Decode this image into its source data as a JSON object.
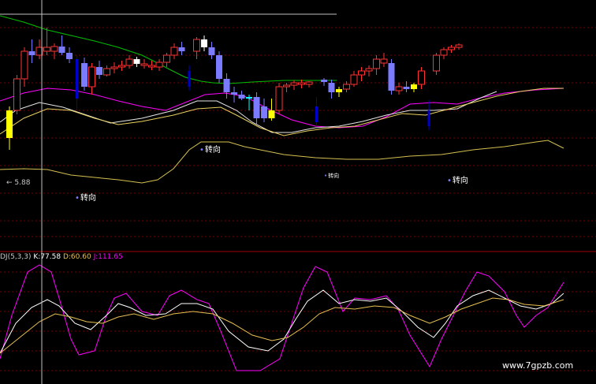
{
  "colors": {
    "background": "#000000",
    "grid": "#7a0000",
    "upper_band": "#00c000",
    "middle_band": "#ff00ff",
    "lower_band": "#d4c050",
    "ma_white": "#e6e6e6",
    "ma_yellow": "#e8d060",
    "candle_up": "#ff3333",
    "candle_down": "#7b7bff",
    "candle_down_solid": "#0000cc",
    "candle_yellow": "#ffff00",
    "candle_cyan": "#00ffff",
    "k_line": "#ffffff",
    "d_line": "#e8c050",
    "j_line": "#ff00ff",
    "crosshair": "#c0c0c0"
  },
  "price_label": "← 5.88",
  "signals": [
    {
      "id": "signal-1",
      "text": "转向"
    },
    {
      "id": "signal-2",
      "text": "转向"
    },
    {
      "id": "signal-3",
      "text": "转向"
    },
    {
      "id": "signal-4",
      "text": "转向"
    }
  ],
  "kdj_legend": {
    "name": "DJ(5,3,3)",
    "k_label": "K:77.58",
    "d_label": "D:60.60",
    "j_label": "J:111.65"
  },
  "watermark": "www.7gpzb.com",
  "candles": [
    {
      "o": 60,
      "h": 100,
      "l": 45,
      "c": 95,
      "col": "yellow"
    },
    {
      "o": 95,
      "h": 140,
      "l": 90,
      "c": 135,
      "col": "up"
    },
    {
      "o": 135,
      "h": 175,
      "l": 125,
      "c": 170,
      "col": "up"
    },
    {
      "o": 170,
      "h": 185,
      "l": 155,
      "c": 165,
      "col": "down"
    },
    {
      "o": 165,
      "h": 185,
      "l": 160,
      "c": 175,
      "col": "up"
    },
    {
      "o": 175,
      "h": 200,
      "l": 165,
      "c": 170,
      "col": "up"
    },
    {
      "o": 170,
      "h": 180,
      "l": 160,
      "c": 176,
      "col": "up"
    },
    {
      "o": 176,
      "h": 190,
      "l": 165,
      "c": 168,
      "col": "down"
    },
    {
      "o": 168,
      "h": 175,
      "l": 155,
      "c": 160,
      "col": "down"
    },
    {
      "o": 160,
      "h": 165,
      "l": 95,
      "c": 110,
      "col": "solid"
    },
    {
      "o": 155,
      "h": 162,
      "l": 120,
      "c": 125,
      "col": "down"
    },
    {
      "o": 125,
      "h": 155,
      "l": 115,
      "c": 150,
      "col": "up"
    },
    {
      "o": 150,
      "h": 158,
      "l": 135,
      "c": 140,
      "col": "down"
    },
    {
      "o": 140,
      "h": 152,
      "l": 138,
      "c": 148,
      "col": "up"
    },
    {
      "o": 148,
      "h": 156,
      "l": 142,
      "c": 150,
      "col": "up"
    },
    {
      "o": 150,
      "h": 158,
      "l": 145,
      "c": 152,
      "col": "up"
    },
    {
      "o": 152,
      "h": 165,
      "l": 148,
      "c": 160,
      "col": "up"
    },
    {
      "o": 160,
      "h": 163,
      "l": 150,
      "c": 154,
      "col": "white"
    },
    {
      "o": 154,
      "h": 160,
      "l": 148,
      "c": 152,
      "col": "up"
    },
    {
      "o": 152,
      "h": 158,
      "l": 146,
      "c": 150,
      "col": "up"
    },
    {
      "o": 150,
      "h": 160,
      "l": 145,
      "c": 156,
      "col": "up"
    },
    {
      "o": 156,
      "h": 168,
      "l": 150,
      "c": 165,
      "col": "up"
    },
    {
      "o": 165,
      "h": 180,
      "l": 160,
      "c": 175,
      "col": "up"
    },
    {
      "o": 175,
      "h": 182,
      "l": 165,
      "c": 170,
      "col": "down"
    },
    {
      "o": 145,
      "h": 152,
      "l": 120,
      "c": 125,
      "col": "solid"
    },
    {
      "o": 170,
      "h": 188,
      "l": 160,
      "c": 185,
      "col": "up"
    },
    {
      "o": 185,
      "h": 190,
      "l": 170,
      "c": 175,
      "col": "white"
    },
    {
      "o": 175,
      "h": 182,
      "l": 160,
      "c": 165,
      "col": "down"
    },
    {
      "o": 165,
      "h": 170,
      "l": 130,
      "c": 135,
      "col": "down"
    },
    {
      "o": 135,
      "h": 142,
      "l": 110,
      "c": 118,
      "col": "down"
    },
    {
      "o": 118,
      "h": 125,
      "l": 105,
      "c": 115,
      "col": "down"
    },
    {
      "o": 115,
      "h": 120,
      "l": 108,
      "c": 110,
      "col": "cross"
    },
    {
      "o": 110,
      "h": 115,
      "l": 95,
      "c": 112,
      "col": "cyan"
    },
    {
      "o": 112,
      "h": 118,
      "l": 78,
      "c": 85,
      "col": "down"
    },
    {
      "o": 85,
      "h": 110,
      "l": 80,
      "c": 100,
      "col": "down"
    },
    {
      "o": 85,
      "h": 110,
      "l": 82,
      "c": 95,
      "col": "yellow"
    },
    {
      "o": 95,
      "h": 130,
      "l": 90,
      "c": 125,
      "col": "up"
    },
    {
      "o": 125,
      "h": 130,
      "l": 118,
      "c": 127,
      "col": "up"
    },
    {
      "o": 127,
      "h": 133,
      "l": 121,
      "c": 130,
      "col": "up"
    },
    {
      "o": 130,
      "h": 134,
      "l": 123,
      "c": 128,
      "col": "up"
    },
    {
      "o": 128,
      "h": 132,
      "l": 124,
      "c": 131,
      "col": "up"
    },
    {
      "o": 100,
      "h": 112,
      "l": 75,
      "c": 80,
      "col": "solid"
    },
    {
      "o": 131,
      "h": 136,
      "l": 126,
      "c": 134,
      "col": "cross"
    },
    {
      "o": 130,
      "h": 134,
      "l": 110,
      "c": 118,
      "col": "down"
    },
    {
      "o": 118,
      "h": 125,
      "l": 112,
      "c": 122,
      "col": "yellow"
    },
    {
      "o": 122,
      "h": 132,
      "l": 118,
      "c": 128,
      "col": "up"
    },
    {
      "o": 128,
      "h": 145,
      "l": 125,
      "c": 140,
      "col": "up"
    },
    {
      "o": 140,
      "h": 150,
      "l": 132,
      "c": 145,
      "col": "up"
    },
    {
      "o": 145,
      "h": 152,
      "l": 138,
      "c": 148,
      "col": "up"
    },
    {
      "o": 148,
      "h": 165,
      "l": 140,
      "c": 160,
      "col": "up"
    },
    {
      "o": 160,
      "h": 168,
      "l": 150,
      "c": 155,
      "col": "up"
    },
    {
      "o": 155,
      "h": 160,
      "l": 115,
      "c": 120,
      "col": "down"
    },
    {
      "o": 120,
      "h": 130,
      "l": 115,
      "c": 125,
      "col": "up"
    },
    {
      "o": 125,
      "h": 132,
      "l": 118,
      "c": 122,
      "col": "down"
    },
    {
      "o": 122,
      "h": 130,
      "l": 118,
      "c": 128,
      "col": "yellow"
    },
    {
      "o": 128,
      "h": 150,
      "l": 122,
      "c": 145,
      "col": "up"
    },
    {
      "o": 95,
      "h": 108,
      "l": 70,
      "c": 75,
      "col": "solid"
    },
    {
      "o": 145,
      "h": 168,
      "l": 140,
      "c": 165,
      "col": "up"
    },
    {
      "o": 165,
      "h": 175,
      "l": 160,
      "c": 172,
      "col": "up"
    },
    {
      "o": 172,
      "h": 178,
      "l": 168,
      "c": 175,
      "col": "up"
    },
    {
      "o": 175,
      "h": 180,
      "l": 172,
      "c": 178,
      "col": "up"
    }
  ]
}
